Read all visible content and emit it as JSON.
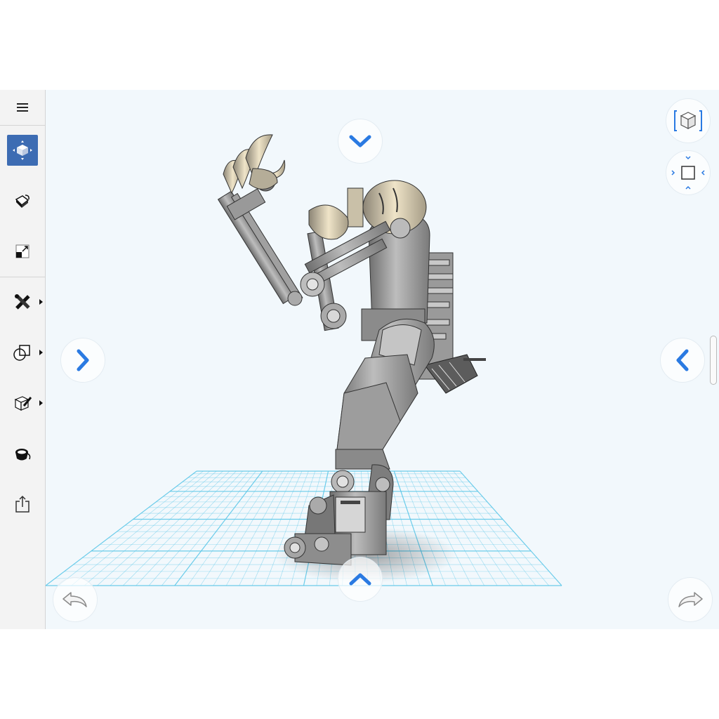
{
  "app": {
    "accent_color": "#3d6cb3",
    "nav_arrow_color": "#2a7ae2",
    "grid_color": "#5cc6e8",
    "background_color": "#f2f8fc"
  },
  "sidebar": {
    "menu_icon": "hamburger-icon",
    "tools": [
      {
        "id": "move",
        "icon": "move-cube-icon",
        "active": true,
        "submenu": false
      },
      {
        "id": "material",
        "icon": "paint-bucket-icon",
        "active": false,
        "submenu": false
      },
      {
        "id": "scale",
        "icon": "scale-icon",
        "active": false,
        "submenu": false
      },
      {
        "id": "modify",
        "icon": "tools-icon",
        "active": false,
        "submenu": true
      },
      {
        "id": "primitives",
        "icon": "shapes-icon",
        "active": false,
        "submenu": true
      },
      {
        "id": "sketch",
        "icon": "sketch-box-icon",
        "active": false,
        "submenu": true
      },
      {
        "id": "paint",
        "icon": "paint-pot-icon",
        "active": false,
        "submenu": false
      },
      {
        "id": "export",
        "icon": "share-icon",
        "active": false,
        "submenu": false
      }
    ]
  },
  "viewport": {
    "nav_buttons": [
      "chevron-down-icon",
      "chevron-up-icon",
      "chevron-right-icon",
      "chevron-left-icon"
    ],
    "view_cube_icon": "view-cube-icon",
    "orbit_icon": "orbit-control-icon",
    "undo_icon": "undo-icon",
    "redo_icon": "redo-icon"
  }
}
